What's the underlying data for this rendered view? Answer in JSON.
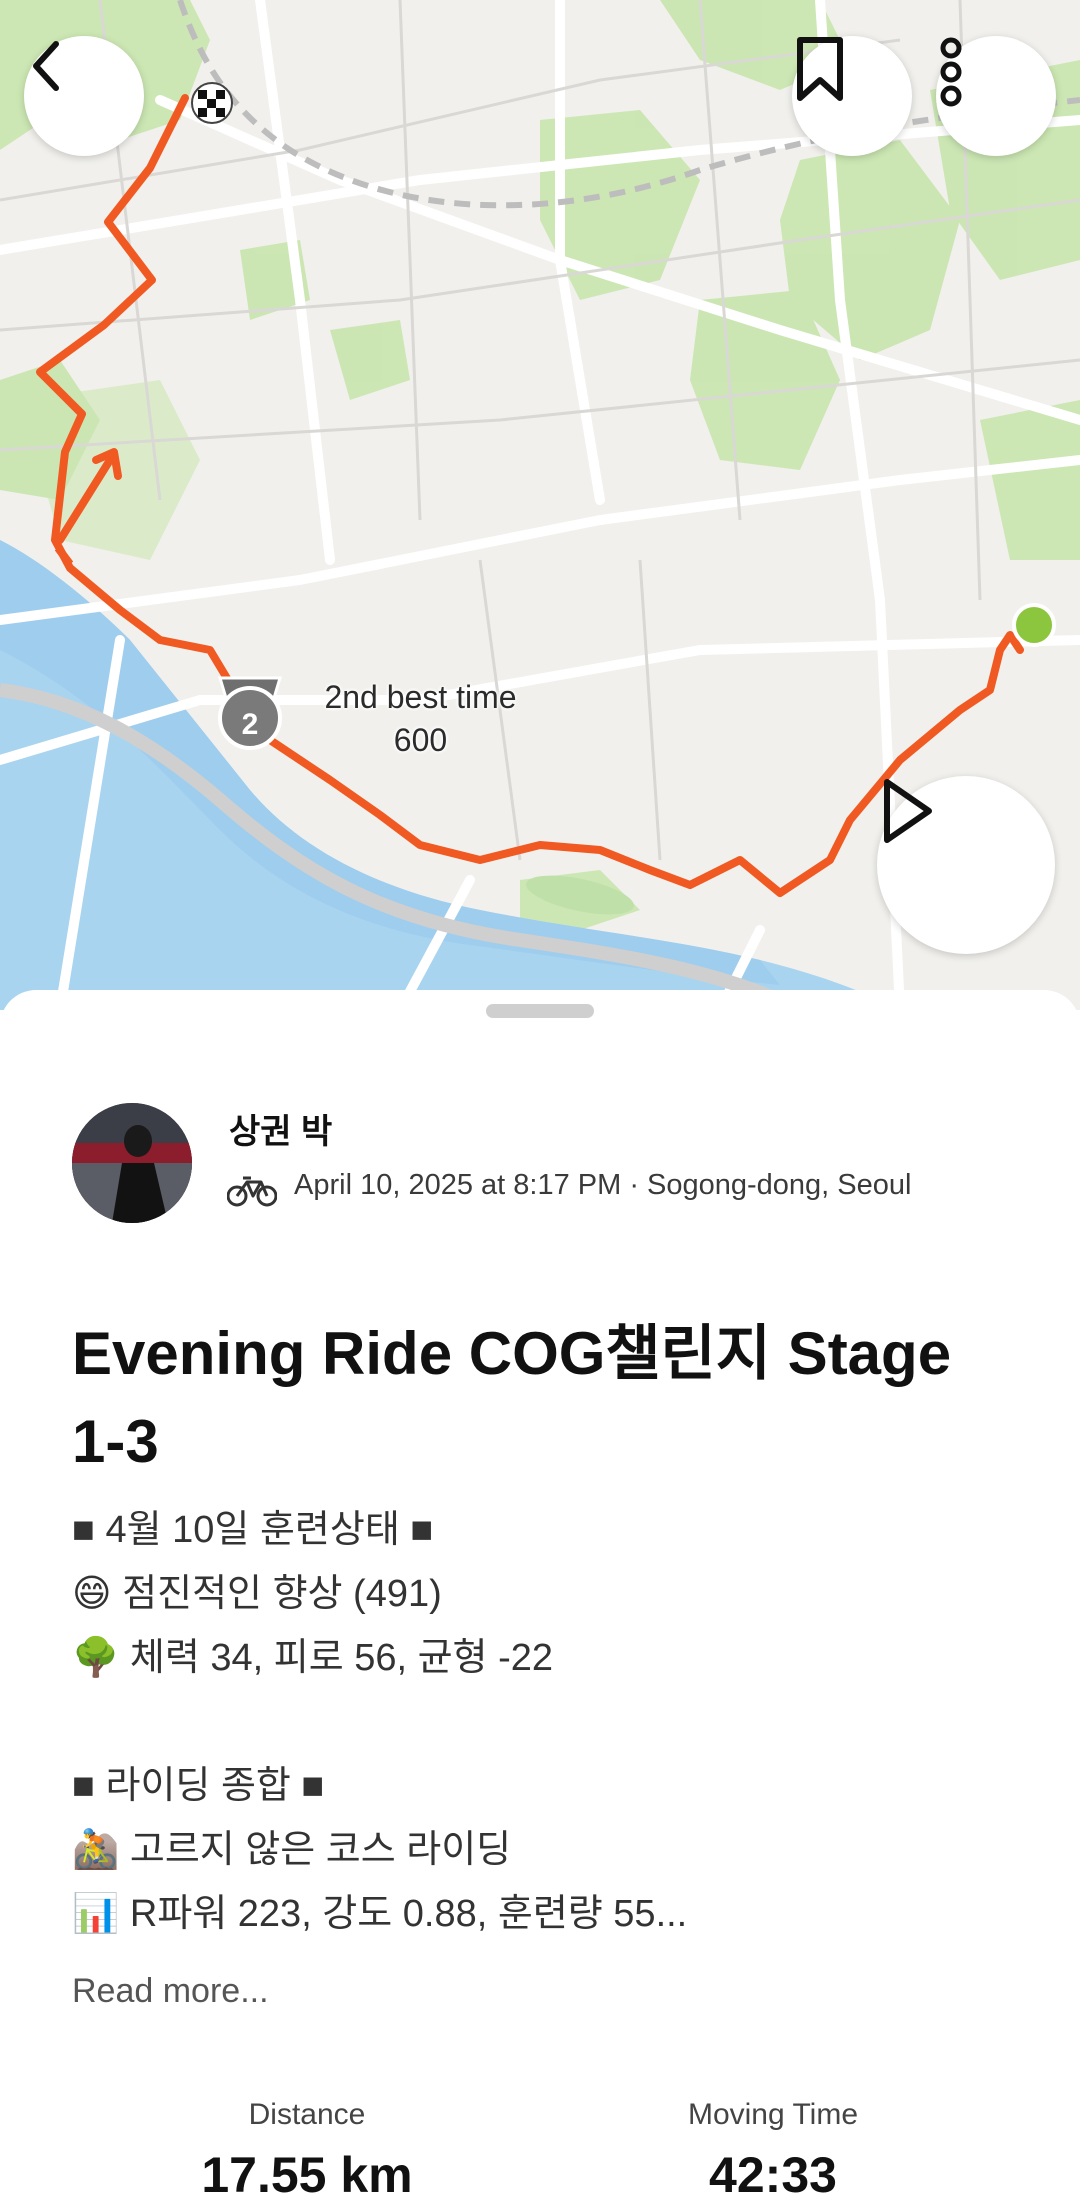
{
  "map": {
    "segment_badge": {
      "rank": "2",
      "label": "2nd best time",
      "value": "600"
    }
  },
  "buttons": {
    "back": "back-icon",
    "bookmark": "bookmark-icon",
    "more": "more-vertical-icon",
    "play": "play-icon"
  },
  "activity": {
    "athlete_name": "상권 박",
    "sport_icon": "bike-icon",
    "meta": "April 10, 2025 at 8:17 PM · Sogong-dong, Seoul",
    "title": "Evening Ride COG챌린지 Stage 1-3",
    "description_lines": [
      "■ 4월 10일 훈련상태 ■",
      "😄 점진적인 향상 (491)",
      "🌳 체력 34, 피로 56, 균형 -22",
      "",
      "■ 라이딩 종합 ■",
      "🚵 고르지 않은 코스 라이딩",
      "📊 R파워 223, 강도 0.88, 훈련량 55..."
    ],
    "read_more": "Read more..."
  },
  "stats": [
    {
      "label": "Distance",
      "value": "17.55 km"
    },
    {
      "label": "Moving Time",
      "value": "42:33"
    }
  ],
  "colors": {
    "route": "#f05a22",
    "start_marker": "#8cc63f",
    "water": "#a8d4f0",
    "park": "#c9e6b0"
  }
}
